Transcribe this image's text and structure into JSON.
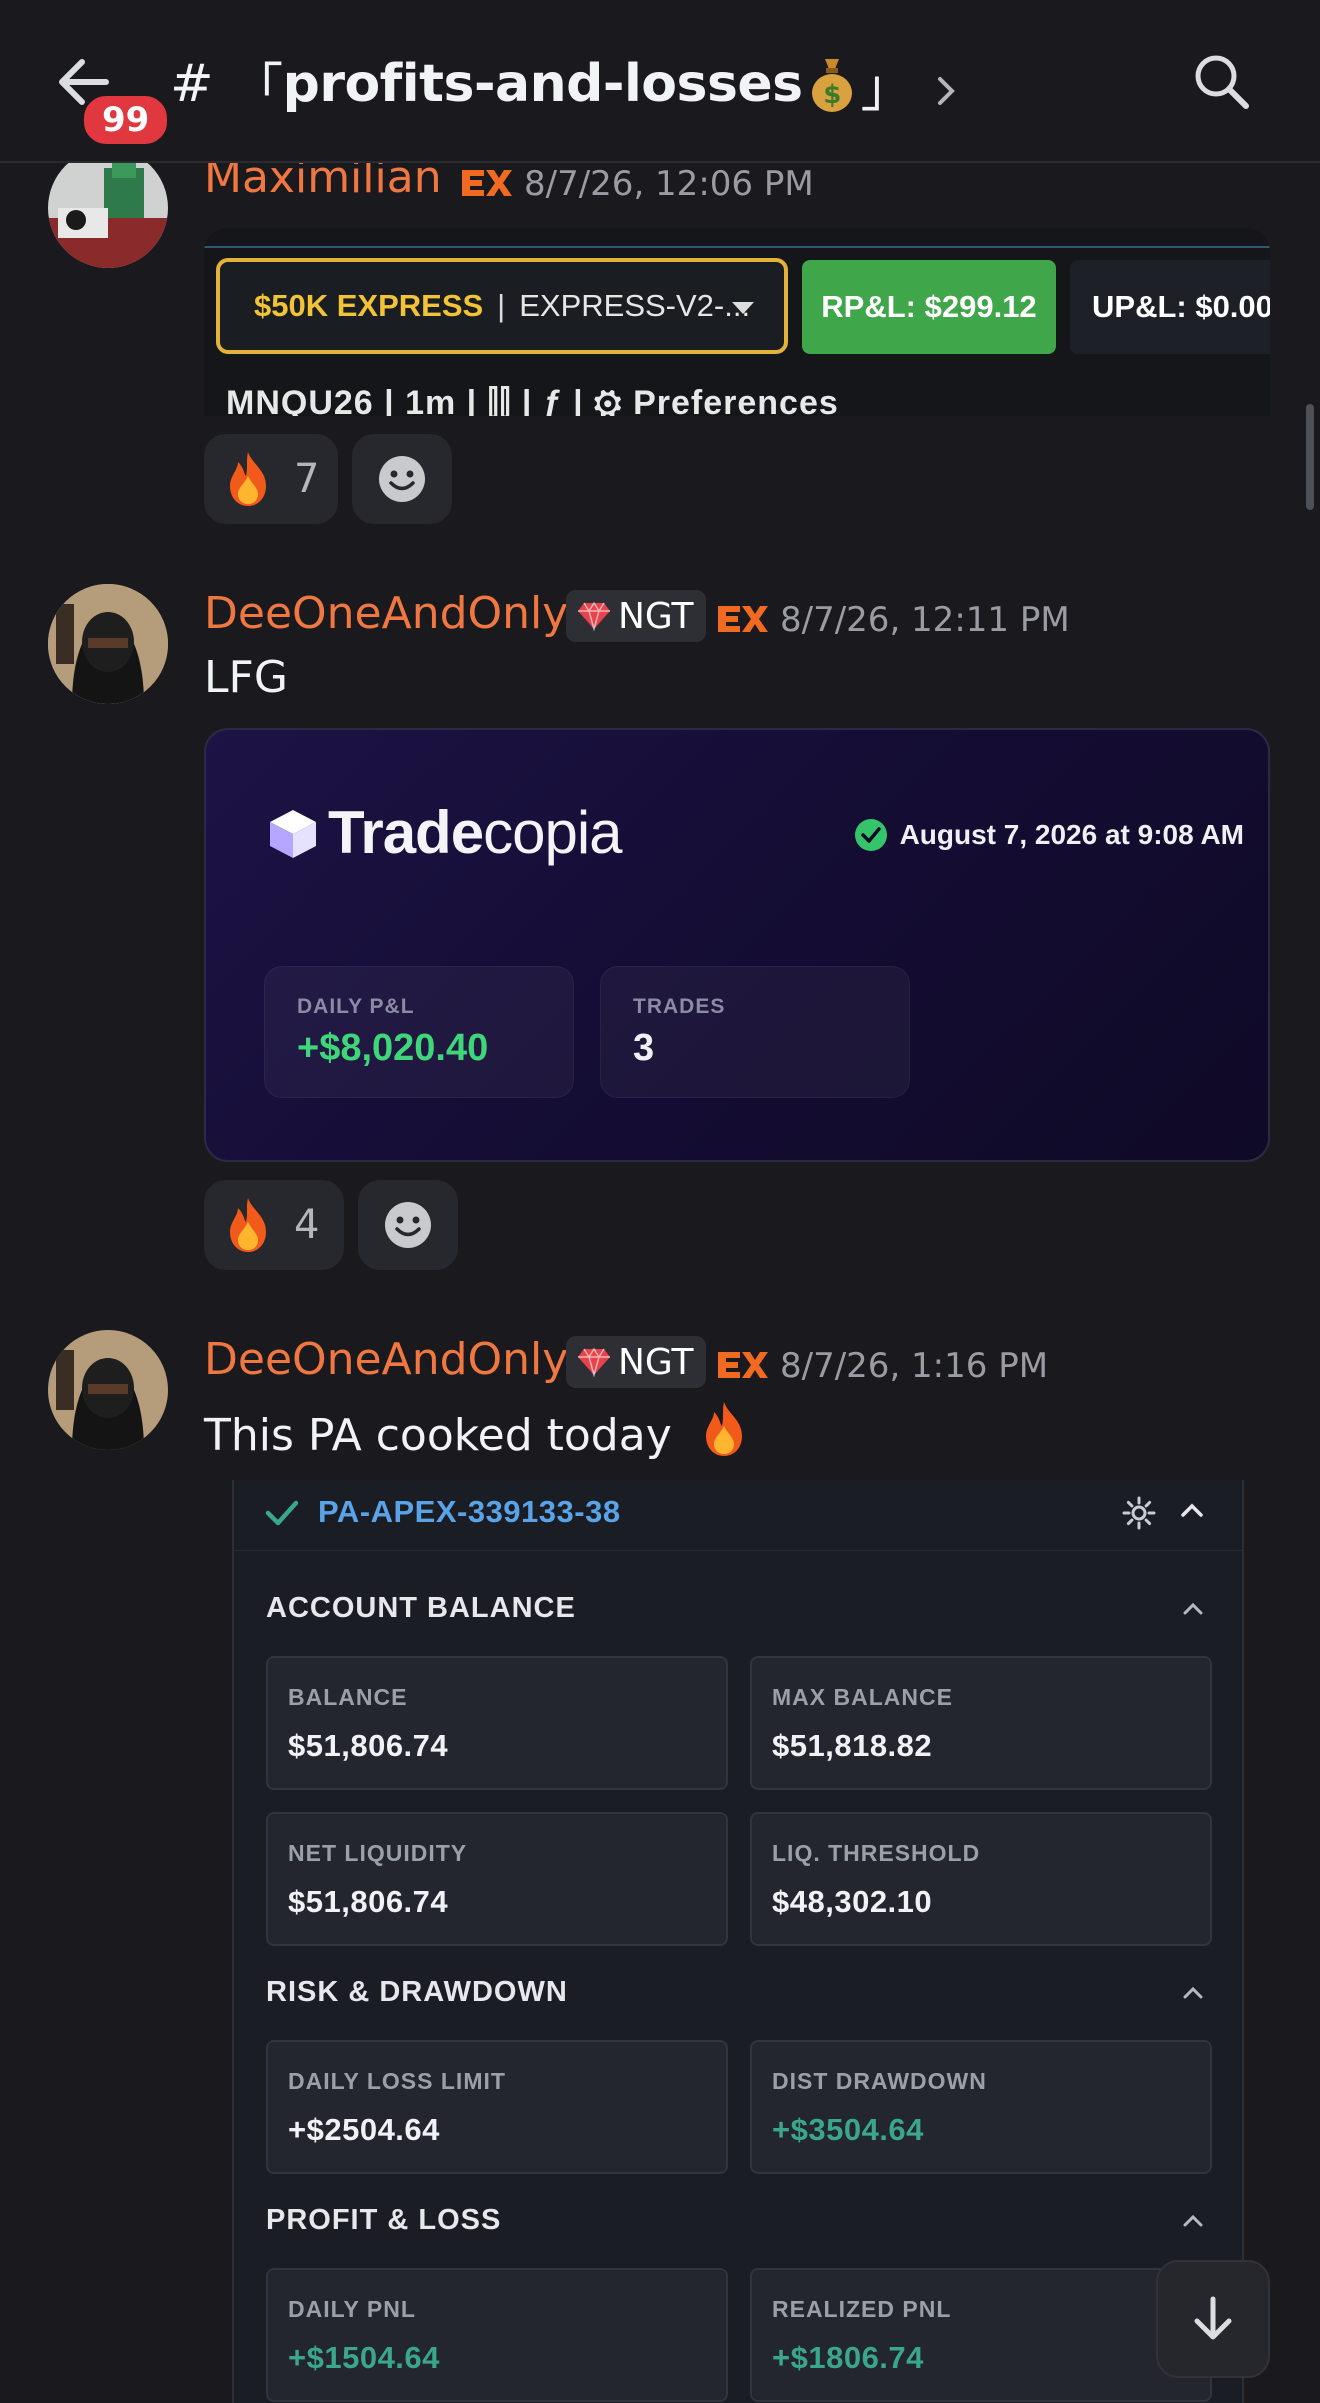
{
  "header": {
    "hash": "#",
    "bracket_open": "「",
    "channel_name": "profits-and-losses",
    "bracket_close": "」",
    "unread_badge": "99"
  },
  "messages": [
    {
      "author": "Maximilian",
      "author_color": "#f07840",
      "timestamp": "8/7/26, 12:06 PM",
      "embed": {
        "account_label": "$50K EXPRESS",
        "separator": "|",
        "account_name": "EXPRESS-V2-...",
        "rpl": "RP&L: $299.12",
        "upl": "UP&L: $0.00",
        "toolbar_partial": "MNQU26   |   1m   |   ⫿⫿   |   ƒ   |   ⚙ Preferences"
      },
      "reactions": [
        {
          "emoji": "fire",
          "count": "7"
        }
      ]
    },
    {
      "author": "DeeOneAndOnly",
      "author_color": "#f07840",
      "role_tag": "NGT",
      "timestamp": "8/7/26, 12:11 PM",
      "text": "LFG",
      "embed": {
        "brand_bold": "Trade",
        "brand_rest": "copia",
        "date": "August 7, 2026 at 9:08 AM",
        "cards": [
          {
            "label": "DAILY P&L",
            "value": "+$8,020.40",
            "positive": true
          },
          {
            "label": "TRADES",
            "value": "3",
            "positive": false
          }
        ]
      },
      "reactions": [
        {
          "emoji": "fire",
          "count": "4"
        }
      ]
    },
    {
      "author": "DeeOneAndOnly",
      "author_color": "#f07840",
      "role_tag": "NGT",
      "timestamp": "8/7/26, 1:16 PM",
      "text": "This PA cooked today",
      "embed": {
        "account_id": "PA-APEX-339133-38",
        "sections": [
          {
            "title": "ACCOUNT BALANCE",
            "stats": [
              {
                "label": "BALANCE",
                "value": "$51,806.74"
              },
              {
                "label": "MAX BALANCE",
                "value": "$51,818.82"
              },
              {
                "label": "NET LIQUIDITY",
                "value": "$51,806.74"
              },
              {
                "label": "LIQ. THRESHOLD",
                "value": "$48,302.10"
              }
            ]
          },
          {
            "title": "RISK & DRAWDOWN",
            "stats": [
              {
                "label": "DAILY LOSS LIMIT",
                "value": "+$2504.64"
              },
              {
                "label": "DIST DRAWDOWN",
                "value": "+$3504.64"
              }
            ]
          },
          {
            "title": "PROFIT & LOSS",
            "stats": [
              {
                "label": "DAILY PNL",
                "value": "+$1504.64"
              },
              {
                "label": "REALIZED PNL",
                "value": "+$1806.74"
              }
            ]
          }
        ]
      }
    }
  ],
  "colors": {
    "background": "#1a1a1e",
    "username": "#f07840",
    "badge": "#e0383e",
    "green_value": "#3aa78a",
    "link_blue": "#5aa3e8"
  }
}
